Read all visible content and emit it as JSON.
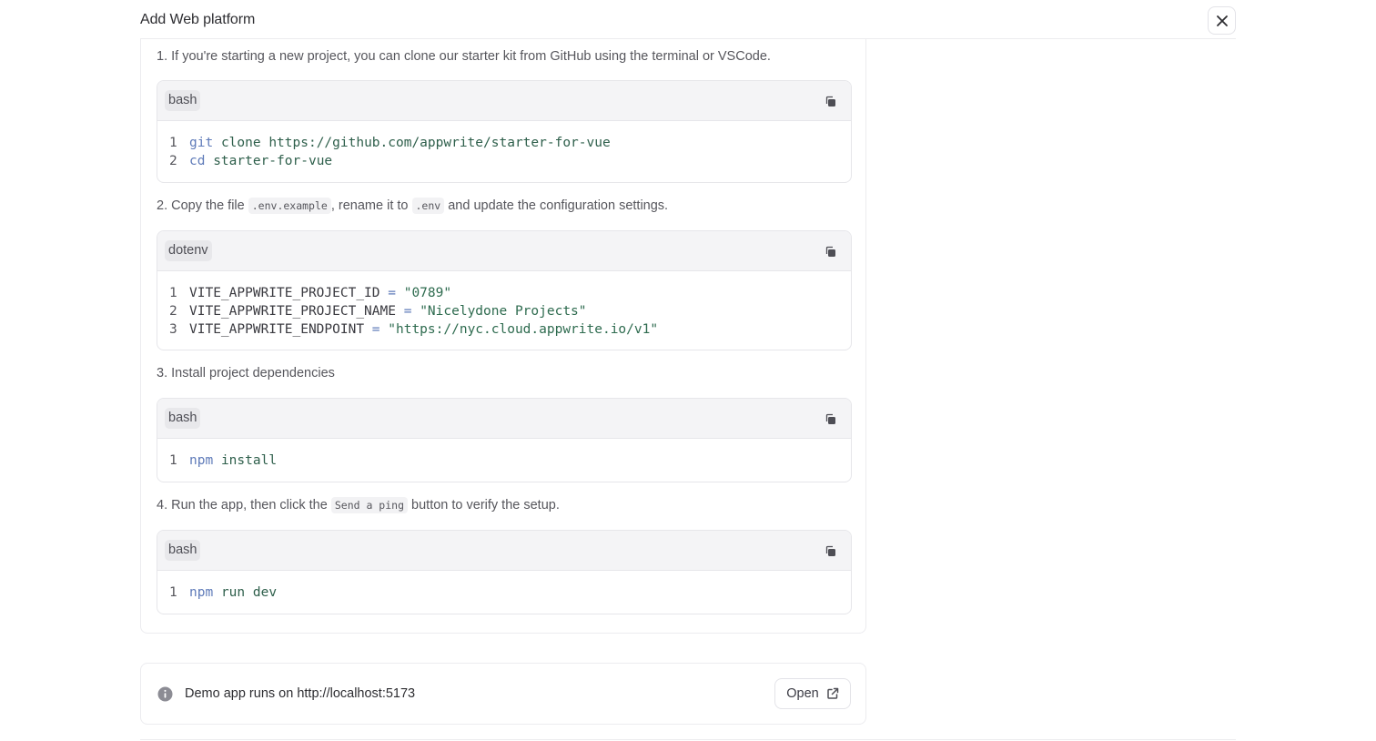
{
  "header": {
    "title": "Add Web platform",
    "close_icon": "close-icon"
  },
  "steps": [
    {
      "parts": [
        "1. If you're starting a new project, you can clone our starter kit from GitHub using the terminal or VSCode."
      ],
      "code": {
        "language": "bash",
        "lines": [
          {
            "num": "1",
            "tokens": [
              "git",
              "clone https://github.com/appwrite/starter-for-vue"
            ]
          },
          {
            "num": "2",
            "tokens": [
              "cd",
              "starter-for-vue"
            ]
          }
        ]
      }
    },
    {
      "parts": [
        "2. Copy the file ",
        ".env.example",
        ", rename it to ",
        ".env",
        " and update the configuration settings."
      ],
      "code": {
        "language": "dotenv",
        "lines": [
          {
            "num": "1",
            "tokens": [
              "VITE_APPWRITE_PROJECT_ID",
              "=",
              "\"0789\""
            ]
          },
          {
            "num": "2",
            "tokens": [
              "VITE_APPWRITE_PROJECT_NAME",
              "=",
              "\"Nicelydone Projects\""
            ]
          },
          {
            "num": "3",
            "tokens": [
              "VITE_APPWRITE_ENDPOINT",
              "=",
              "\"https://nyc.cloud.appwrite.io/v1\""
            ]
          }
        ]
      }
    },
    {
      "parts": [
        "3. Install project dependencies"
      ],
      "code": {
        "language": "bash",
        "lines": [
          {
            "num": "1",
            "tokens": [
              "npm",
              "install"
            ]
          }
        ]
      }
    },
    {
      "parts": [
        "4. Run the app, then click the ",
        "Send a ping",
        " button to verify the setup."
      ],
      "code": {
        "language": "bash",
        "lines": [
          {
            "num": "1",
            "tokens": [
              "npm",
              "run dev"
            ]
          }
        ]
      }
    }
  ],
  "demo": {
    "text": "Demo app runs on http://localhost:5173",
    "open_label": "Open",
    "info_icon": "info-icon",
    "external_icon": "external-link-icon"
  },
  "icons": {
    "copy": "copy-icon"
  },
  "colors": {
    "keyword": "#5f7bb9",
    "string": "#2e6b4f",
    "border": "#ececef"
  }
}
